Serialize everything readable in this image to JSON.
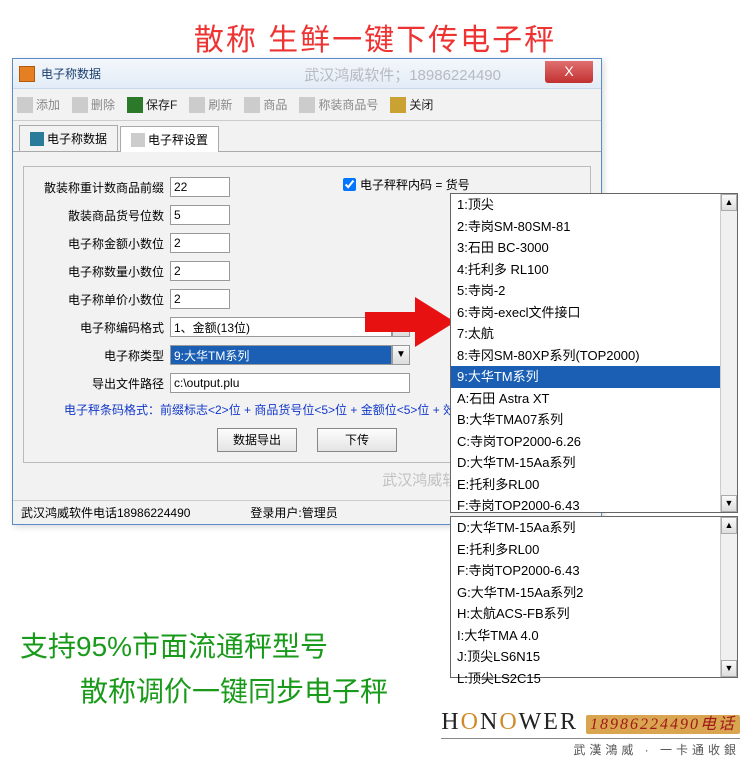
{
  "banner_top": "散称 生鲜一键下传电子秤",
  "window": {
    "title": "电子称数据",
    "watermark": "武汉鸿威软件；18986224490",
    "close_glyph": "X"
  },
  "toolbar": {
    "add": "添加",
    "del": "删除",
    "save": "保存F",
    "refresh": "刷新",
    "goods": "商品",
    "scale_goods": "称装商品号",
    "close": "关闭"
  },
  "tabs": {
    "data": "电子称数据",
    "setting": "电子秤设置"
  },
  "form": {
    "prefix_label": "散装称重计数商品前缀",
    "prefix_val": "22",
    "code_digits_label": "散装商品货号位数",
    "code_digits_val": "5",
    "amount_dec_label": "电子称金额小数位",
    "amount_dec_val": "2",
    "qty_dec_label": "电子称数量小数位",
    "qty_dec_val": "2",
    "price_dec_label": "电子称单价小数位",
    "price_dec_val": "2",
    "encode_label": "电子称编码格式",
    "encode_val": "1、金额(13位)",
    "type_label": "电子称类型",
    "type_val": "9:大华TM系列",
    "export_label": "导出文件路径",
    "export_val": "c:\\output.plu",
    "chk_label": "电子秤秤内码 = 货号"
  },
  "hint": "电子秤条码格式：前缀标志<2>位 + 商品货号位<5>位 + 金额位<5>位 + 效",
  "buttons": {
    "export": "数据导出",
    "download": "下传"
  },
  "statusbar": {
    "phone": "武汉鸿威软件电话18986224490",
    "user": "登录用户:管理员"
  },
  "dropdown1": [
    "1:顶尖",
    "2:寺岗SM-80SM-81",
    "3:石田 BC-3000",
    "4:托利多 RL100",
    "5:寺岗-2",
    "6:寺岗-execl文件接口",
    "7:太航",
    "8:寺冈SM-80XP系列(TOP2000)",
    "9:大华TM系列",
    "A:石田 Astra XT",
    "B:大华TMA07系列",
    "C:寺岗TOP2000-6.26",
    "D:大华TM-15Aa系列",
    "E:托利多RL00",
    "F:寺岗TOP2000-6.43",
    "G:大华TM-15Aa系列2"
  ],
  "dropdown1_selected_index": 8,
  "dropdown2": [
    "D:大华TM-15Aa系列",
    "E:托利多RL00",
    "F:寺岗TOP2000-6.43",
    "G:大华TM-15Aa系列2",
    "H:太航ACS-FB系列",
    "I:大华TMA 4.0",
    "J:顶尖LS6N15",
    "L:顶尖LS2C15"
  ],
  "banner_bot1": "支持95%市面流通秤型号",
  "banner_bot2": "散称调价一键同步电子秤",
  "logo": {
    "pre": "H",
    "o1": "O",
    "mid": "N",
    "o2": "O",
    "post": "WER",
    "phone": "18986224490电话",
    "sub": "武漢鴻威 · 一卡通收銀"
  }
}
